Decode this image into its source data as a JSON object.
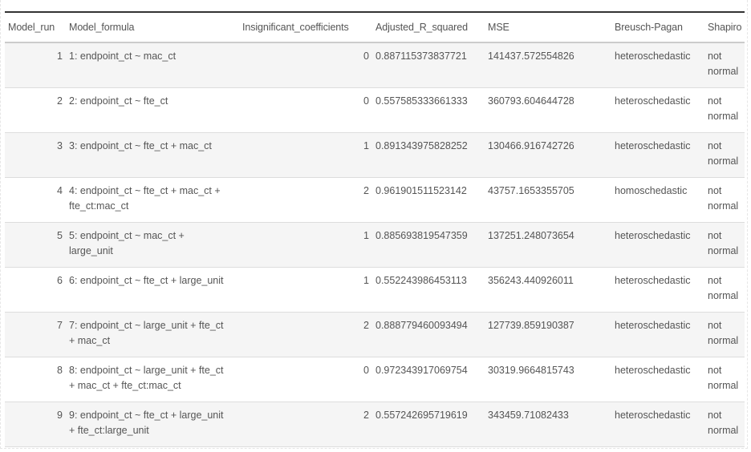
{
  "table": {
    "columns": [
      "Model_run",
      "Model_formula",
      "Insignificant_coefficients",
      "Adjusted_R_squared",
      "MSE",
      "Breusch-Pagan",
      "Shapiro"
    ],
    "rows": [
      {
        "model_run": "1",
        "formula": "1: endpoint_ct ~ mac_ct",
        "insignificant": "0",
        "adj_r2": "0.887115373837721",
        "mse": "141437.572554826",
        "breusch_pagan": "heteroschedastic",
        "shapiro": "not normal"
      },
      {
        "model_run": "2",
        "formula": "2: endpoint_ct ~ fte_ct",
        "insignificant": "0",
        "adj_r2": "0.557585333661333",
        "mse": "360793.604644728",
        "breusch_pagan": "heteroschedastic",
        "shapiro": "not normal"
      },
      {
        "model_run": "3",
        "formula": "3: endpoint_ct ~ fte_ct + mac_ct",
        "insignificant": "1",
        "adj_r2": "0.891343975828252",
        "mse": "130466.916742726",
        "breusch_pagan": "heteroschedastic",
        "shapiro": "not normal"
      },
      {
        "model_run": "4",
        "formula": "4: endpoint_ct ~ fte_ct + mac_ct + fte_ct:mac_ct",
        "insignificant": "2",
        "adj_r2": "0.961901511523142",
        "mse": "43757.1653355705",
        "breusch_pagan": "homoschedastic",
        "shapiro": "not normal"
      },
      {
        "model_run": "5",
        "formula": "5: endpoint_ct ~ mac_ct + large_unit",
        "insignificant": "1",
        "adj_r2": "0.885693819547359",
        "mse": "137251.248073654",
        "breusch_pagan": "heteroschedastic",
        "shapiro": "not normal"
      },
      {
        "model_run": "6",
        "formula": "6: endpoint_ct ~ fte_ct + large_unit",
        "insignificant": "1",
        "adj_r2": "0.552243986453113",
        "mse": "356243.440926011",
        "breusch_pagan": "heteroschedastic",
        "shapiro": "not normal"
      },
      {
        "model_run": "7",
        "formula": "7: endpoint_ct ~ large_unit + fte_ct + mac_ct",
        "insignificant": "2",
        "adj_r2": "0.888779460093494",
        "mse": "127739.859190387",
        "breusch_pagan": "heteroschedastic",
        "shapiro": "not normal"
      },
      {
        "model_run": "8",
        "formula": "8: endpoint_ct ~ large_unit + fte_ct + mac_ct + fte_ct:mac_ct",
        "insignificant": "0",
        "adj_r2": "0.972343917069754",
        "mse": "30319.9664815743",
        "breusch_pagan": "heteroschedastic",
        "shapiro": "not normal"
      },
      {
        "model_run": "9",
        "formula": "9: endpoint_ct ~ fte_ct + large_unit + fte_ct:large_unit",
        "insignificant": "2",
        "adj_r2": "0.557242695719619",
        "mse": "343459.71082433",
        "breusch_pagan": "heteroschedastic",
        "shapiro": "not normal"
      }
    ]
  }
}
